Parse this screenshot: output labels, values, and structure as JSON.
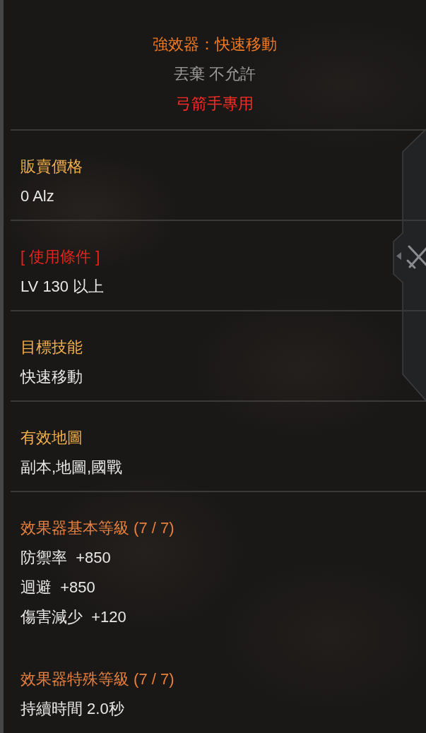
{
  "header": {
    "title": "強效器：快速移動",
    "trade_note": "丟棄 不允許",
    "class_restriction": "弓箭手專用"
  },
  "sections": [
    {
      "entries": [
        {
          "label": "販賣價格",
          "color": "#f2b04a",
          "lines": [
            "0 Alz"
          ]
        }
      ]
    },
    {
      "entries": [
        {
          "label": "[ 使用條件 ]",
          "color": "#e8231c",
          "lines": [
            "LV 130 以上"
          ]
        }
      ]
    },
    {
      "entries": [
        {
          "label": "目標技能",
          "color": "#f2b04a",
          "lines": [
            "快速移動"
          ]
        }
      ]
    },
    {
      "entries": [
        {
          "label": "有效地圖",
          "color": "#f2b04a",
          "lines": [
            "副本,地圖,國戰"
          ]
        }
      ]
    },
    {
      "entries": [
        {
          "label": "效果器基本等級 (7 / 7)",
          "color": "#e8803e",
          "lines": [
            "防禦率  +850",
            "迴避  +850",
            "傷害減少  +120"
          ]
        },
        {
          "label": "效果器特殊等級 (7 / 7)",
          "color": "#e8803e",
          "lines": [
            "持續時間 2.0秒"
          ]
        }
      ]
    }
  ]
}
